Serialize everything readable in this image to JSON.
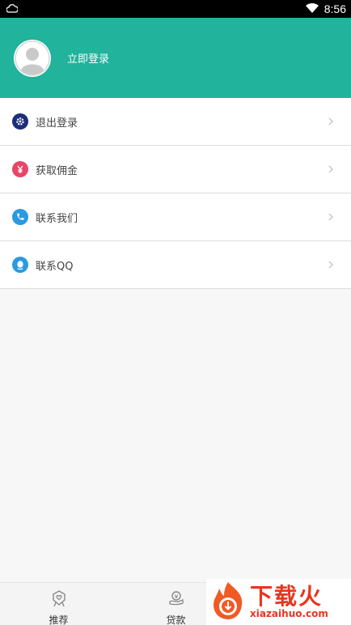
{
  "status_bar": {
    "time": "8:56",
    "left_icon": "cloud-icon",
    "right_icon": "wifi-icon"
  },
  "header": {
    "login_label": "立即登录",
    "avatar_icon": "user-avatar-icon",
    "bg_color": "#21b39b"
  },
  "menu": {
    "items": [
      {
        "label": "退出登录",
        "icon": "gear-icon",
        "icon_color": "#1d2d78"
      },
      {
        "label": "获取佣金",
        "icon": "yen-icon",
        "icon_color": "#e84567"
      },
      {
        "label": "联系我们",
        "icon": "phone-icon",
        "icon_color": "#2a9ae2"
      },
      {
        "label": "联系QQ",
        "icon": "qq-icon",
        "icon_color": "#2a9ae2"
      }
    ]
  },
  "tabbar": {
    "tabs": [
      {
        "label": "推荐",
        "icon": "recommend-icon"
      },
      {
        "label": "贷款",
        "icon": "loan-icon"
      }
    ]
  },
  "watermark": {
    "title": "下载火",
    "subtitle": "xiazaihuo.com",
    "color": "#e8361d"
  }
}
